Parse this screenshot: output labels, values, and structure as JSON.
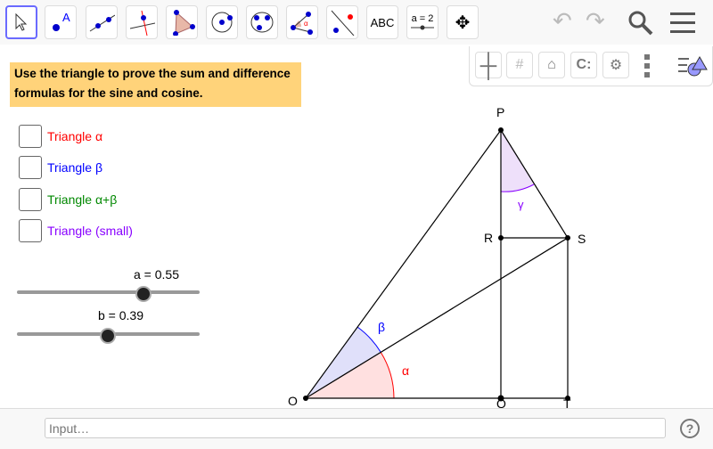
{
  "toolbar": {
    "tools": [
      {
        "name": "move-tool"
      },
      {
        "name": "point-tool",
        "label": "A"
      },
      {
        "name": "line-tool"
      },
      {
        "name": "perpendicular-line-tool"
      },
      {
        "name": "polygon-tool"
      },
      {
        "name": "circle-tool"
      },
      {
        "name": "conic-tool"
      },
      {
        "name": "angle-tool",
        "label": "α"
      },
      {
        "name": "reflect-tool"
      },
      {
        "name": "text-tool",
        "label": "ABC"
      },
      {
        "name": "slider-tool",
        "label": "a = 2"
      },
      {
        "name": "move-graphics-tool"
      }
    ]
  },
  "task": "Use the triangle to prove the sum and difference formulas for the sine and cosine.",
  "checkboxes": [
    {
      "label": "Triangle α",
      "color": "#ff0000"
    },
    {
      "label": "Triangle β",
      "color": "#0000ff"
    },
    {
      "label": "Triangle α+β",
      "color": "#008000"
    },
    {
      "label": "Triangle (small)",
      "color": "#8000ff"
    }
  ],
  "sliders": [
    {
      "label": "a = 0.55",
      "value": 0.55
    },
    {
      "label": "b = 0.39",
      "value": 0.39
    }
  ],
  "points": {
    "O": "O",
    "P": "P",
    "R": "R",
    "S": "S",
    "Q": "Q",
    "T": "T"
  },
  "angles": {
    "alpha": "α",
    "beta": "β",
    "gamma": "γ"
  },
  "input": {
    "placeholder": "Input…"
  },
  "help": "?"
}
